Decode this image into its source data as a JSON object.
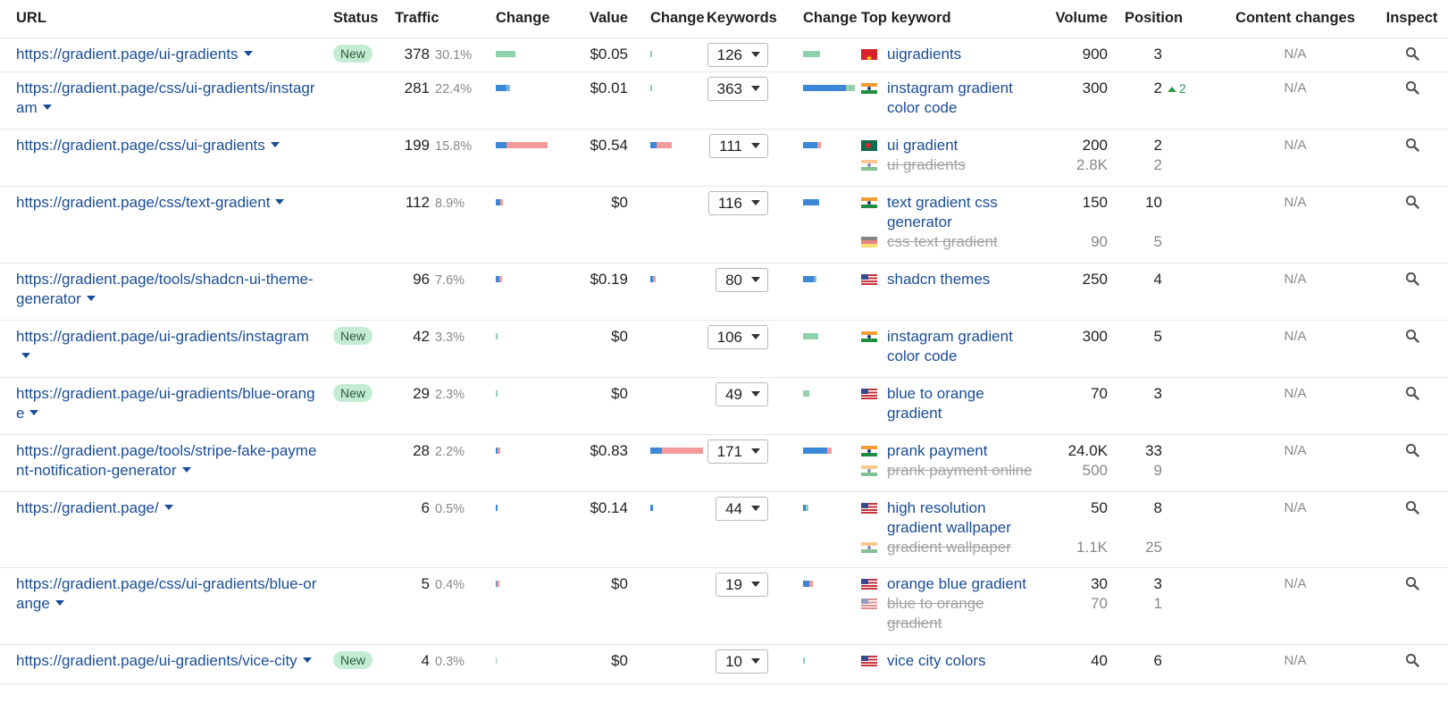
{
  "headers": {
    "url": "URL",
    "status": "Status",
    "traffic": "Traffic",
    "change1": "Change",
    "value": "Value",
    "change2": "Change",
    "keywords": "Keywords",
    "change3": "Change",
    "top_keyword": "Top keyword",
    "volume": "Volume",
    "position": "Position",
    "content_changes": "Content changes",
    "inspect": "Inspect"
  },
  "colors": {
    "link": "#1a4d96",
    "badge_bg": "#c4ecd4",
    "bar_green": "#8fd1aa",
    "bar_blue": "#3d87d8",
    "bar_red": "#f29a9a",
    "up_green": "#2a9a4a"
  },
  "rows": [
    {
      "url": "https://gradient.page/ui-gradients",
      "status": "New",
      "traffic": "378",
      "traffic_pct": "30.1%",
      "value": "$0.05",
      "keywords": "126",
      "top": [
        {
          "flag": "vn",
          "kw": "uigradients",
          "volume": "900",
          "position": "3",
          "old": false
        }
      ],
      "content": "N/A"
    },
    {
      "url": "https://gradient.page/css/ui-gradients/instagram",
      "status": "",
      "traffic": "281",
      "traffic_pct": "22.4%",
      "value": "$0.01",
      "keywords": "363",
      "top": [
        {
          "flag": "in",
          "kw": "instagram gradient color code",
          "volume": "300",
          "position": "2",
          "pos_change": "2",
          "old": false
        }
      ],
      "content": "N/A"
    },
    {
      "url": "https://gradient.page/css/ui-gradients",
      "status": "",
      "traffic": "199",
      "traffic_pct": "15.8%",
      "value": "$0.54",
      "keywords": "111",
      "top": [
        {
          "flag": "bd",
          "kw": "ui gradient",
          "volume": "200",
          "position": "2",
          "old": false
        },
        {
          "flag": "in",
          "kw": "ui gradients",
          "volume": "2.8K",
          "position": "2",
          "old": true
        }
      ],
      "content": "N/A"
    },
    {
      "url": "https://gradient.page/css/text-gradient",
      "status": "",
      "traffic": "112",
      "traffic_pct": "8.9%",
      "value": "$0",
      "keywords": "116",
      "top": [
        {
          "flag": "in",
          "kw": "text gradient css generator",
          "volume": "150",
          "position": "10",
          "old": false
        },
        {
          "flag": "de",
          "kw": "css text gradient",
          "volume": "90",
          "position": "5",
          "old": true
        }
      ],
      "content": "N/A"
    },
    {
      "url": "https://gradient.page/tools/shadcn-ui-theme-generator",
      "status": "",
      "traffic": "96",
      "traffic_pct": "7.6%",
      "value": "$0.19",
      "keywords": "80",
      "top": [
        {
          "flag": "us",
          "kw": "shadcn themes",
          "volume": "250",
          "position": "4",
          "old": false
        }
      ],
      "content": "N/A"
    },
    {
      "url": "https://gradient.page/ui-gradients/instagram",
      "status": "New",
      "traffic": "42",
      "traffic_pct": "3.3%",
      "value": "$0",
      "keywords": "106",
      "top": [
        {
          "flag": "in",
          "kw": "instagram gradient color code",
          "volume": "300",
          "position": "5",
          "old": false
        }
      ],
      "content": "N/A"
    },
    {
      "url": "https://gradient.page/ui-gradients/blue-orange",
      "status": "New",
      "traffic": "29",
      "traffic_pct": "2.3%",
      "value": "$0",
      "keywords": "49",
      "top": [
        {
          "flag": "us",
          "kw": "blue to orange gradient",
          "volume": "70",
          "position": "3",
          "old": false
        }
      ],
      "content": "N/A"
    },
    {
      "url": "https://gradient.page/tools/stripe-fake-payment-notification-generator",
      "status": "",
      "traffic": "28",
      "traffic_pct": "2.2%",
      "value": "$0.83",
      "keywords": "171",
      "top": [
        {
          "flag": "in",
          "kw": "prank payment",
          "volume": "24.0K",
          "position": "33",
          "old": false
        },
        {
          "flag": "in",
          "kw": "prank payment online",
          "volume": "500",
          "position": "9",
          "old": true
        }
      ],
      "content": "N/A"
    },
    {
      "url": "https://gradient.page/",
      "status": "",
      "traffic": "6",
      "traffic_pct": "0.5%",
      "value": "$0.14",
      "keywords": "44",
      "top": [
        {
          "flag": "us",
          "kw": "high resolution gradient wallpaper",
          "volume": "50",
          "position": "8",
          "old": false
        },
        {
          "flag": "in",
          "kw": "gradient wallpaper",
          "volume": "1.1K",
          "position": "25",
          "old": true
        }
      ],
      "content": "N/A"
    },
    {
      "url": "https://gradient.page/css/ui-gradients/blue-orange",
      "status": "",
      "traffic": "5",
      "traffic_pct": "0.4%",
      "value": "$0",
      "keywords": "19",
      "top": [
        {
          "flag": "us",
          "kw": "orange blue gradient",
          "volume": "30",
          "position": "3",
          "old": false
        },
        {
          "flag": "us",
          "kw": "blue to orange gradient",
          "volume": "70",
          "position": "1",
          "old": true
        }
      ],
      "content": "N/A"
    },
    {
      "url": "https://gradient.page/ui-gradients/vice-city",
      "status": "New",
      "traffic": "4",
      "traffic_pct": "0.3%",
      "value": "$0",
      "keywords": "10",
      "top": [
        {
          "flag": "us",
          "kw": "vice city colors",
          "volume": "40",
          "position": "6",
          "old": false
        }
      ],
      "content": "N/A"
    }
  ]
}
